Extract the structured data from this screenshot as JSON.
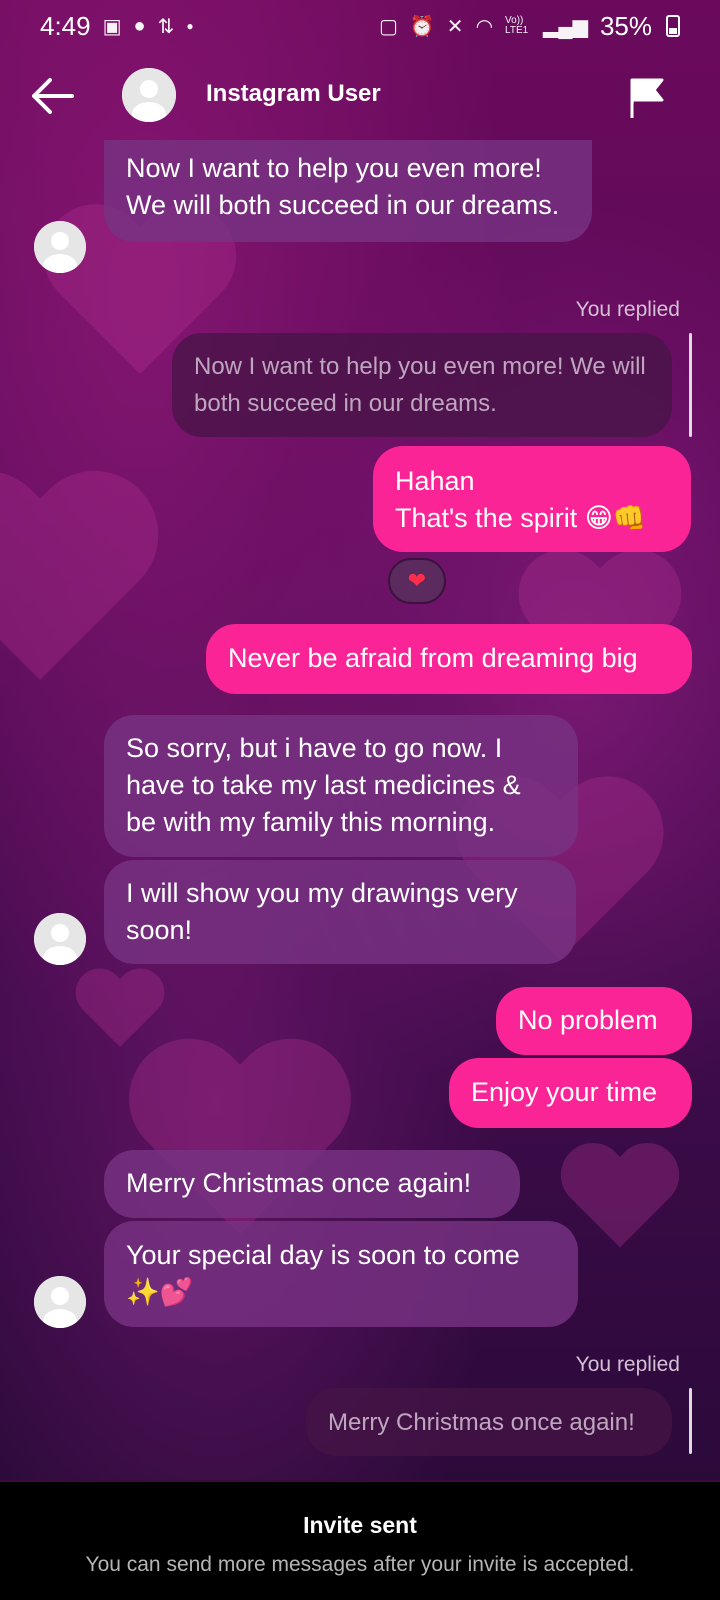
{
  "status_bar": {
    "time": "4:49",
    "battery": "35%",
    "signal_label": "Vo)) LTE1"
  },
  "header": {
    "name": "Instagram User"
  },
  "messages": {
    "m1": "Now I want to help you even more! We will both succeed in our dreams.",
    "replied_label_1": "You replied",
    "reply_quote_1": "Now I want to help you even more! We will both succeed in our dreams.",
    "m2_line1": "Hahan",
    "m2_line2": "That's the spirit 😁👊",
    "reaction": "❤",
    "m3": "Never be afraid from dreaming big",
    "m4": "So sorry, but i have to go now. I have to take my last medicines & be with my family this morning.",
    "m5": "I will show you my drawings very soon!",
    "m6": "No problem",
    "m7": "Enjoy your time",
    "m8": "Merry Christmas once again!",
    "m9": "Your special day is soon to come ✨💕",
    "replied_label_2": "You replied",
    "reply_quote_2": "Merry Christmas once again!"
  },
  "bottom": {
    "title": "Invite sent",
    "subtitle": "You can send more messages after your invite is accepted."
  },
  "colors": {
    "outgoing_bubble": "#fb2496",
    "incoming_bubble": "#7a3282",
    "background_top": "#6b0a5c",
    "background_bottom": "#2b0a3a"
  }
}
